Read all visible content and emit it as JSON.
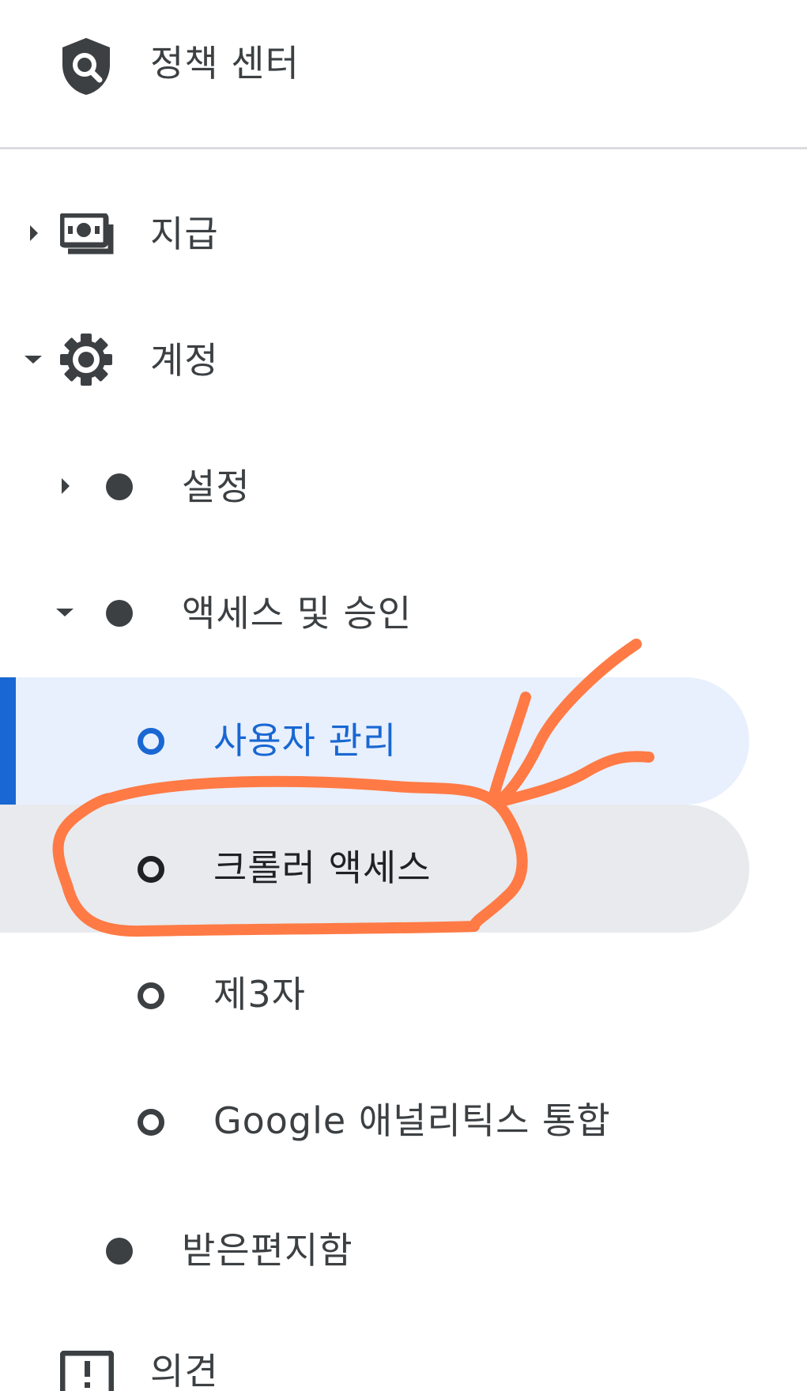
{
  "nav": {
    "policy_center": {
      "label": "정책 센터",
      "icon": "shield-search-icon"
    },
    "payments": {
      "label": "지급",
      "icon": "payments-icon",
      "expanded": false
    },
    "account": {
      "label": "계정",
      "icon": "gear-icon",
      "expanded": true,
      "children": {
        "settings": {
          "label": "설정",
          "expanded": false
        },
        "access": {
          "label": "액세스 및 승인",
          "expanded": true,
          "children": [
            {
              "label": "사용자 관리",
              "selected": true
            },
            {
              "label": "크롤러 액세스",
              "hovered": true
            },
            {
              "label": "제3자"
            },
            {
              "label": "Google 애널리틱스 통합"
            }
          ]
        },
        "inbox": {
          "label": "받은편지함"
        }
      }
    },
    "feedback": {
      "label": "의견",
      "icon": "feedback-icon"
    }
  },
  "colors": {
    "text": "#3c4043",
    "selected_text": "#1967d2",
    "selected_bg": "#e8f0fe",
    "hover_bg": "#e8eaed",
    "annotation": "#ff7a45"
  }
}
